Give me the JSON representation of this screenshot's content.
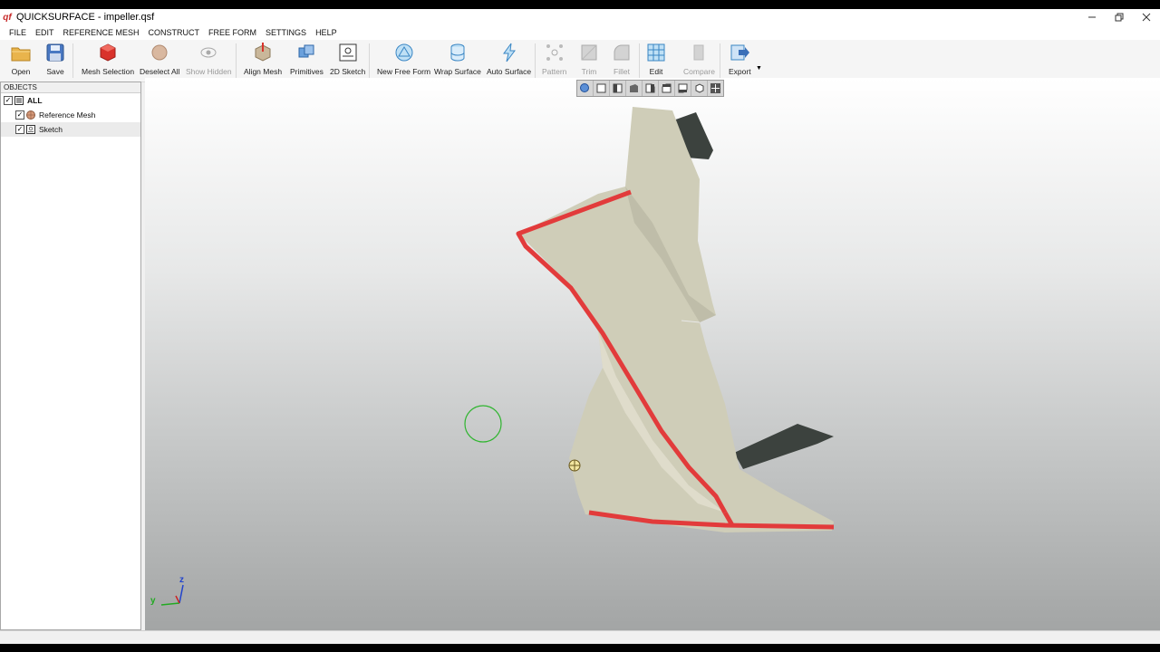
{
  "window": {
    "title": "QUICKSURFACE - impeller.qsf",
    "logo_text": "qf",
    "controls": [
      "minimize-icon",
      "restore-icon",
      "close-icon"
    ]
  },
  "menu": [
    "FILE",
    "EDIT",
    "REFERENCE MESH",
    "CONSTRUCT",
    "FREE FORM",
    "SETTINGS",
    "HELP"
  ],
  "toolbar": {
    "open": "Open",
    "save": "Save",
    "mesh_selection": "Mesh Selection",
    "deselect_all": "Deselect All",
    "show_hidden": "Show Hidden",
    "align_mesh": "Align Mesh",
    "primitives": "Primitives",
    "sketch_2d": "2D Sketch",
    "new_free_form": "New Free Form",
    "wrap_surface": "Wrap Surface",
    "auto_surface": "Auto Surface",
    "pattern": "Pattern",
    "trim": "Trim",
    "fillet": "Fillet",
    "edit": "Edit",
    "compare": "Compare",
    "export": "Export"
  },
  "objects_panel": {
    "header": "OBJECTS",
    "items": [
      {
        "label": "ALL",
        "checked": true
      },
      {
        "label": "Reference Mesh",
        "checked": true
      },
      {
        "label": "Sketch",
        "checked": true
      }
    ]
  },
  "viewport": {
    "axis": {
      "z": "z",
      "y": "y"
    },
    "view_buttons": [
      "zoom-fit-icon",
      "view-front-icon",
      "view-back-icon",
      "view-left-icon",
      "view-right-icon",
      "view-top-icon",
      "view-bottom-icon",
      "view-iso-icon",
      "view-rotate-icon"
    ]
  },
  "colors": {
    "mesh": "#cfcdb8",
    "mesh_edge_highlight": "#e23b3b",
    "selection_circle": "#2fb52f",
    "dark_patch": "#3c423e"
  }
}
